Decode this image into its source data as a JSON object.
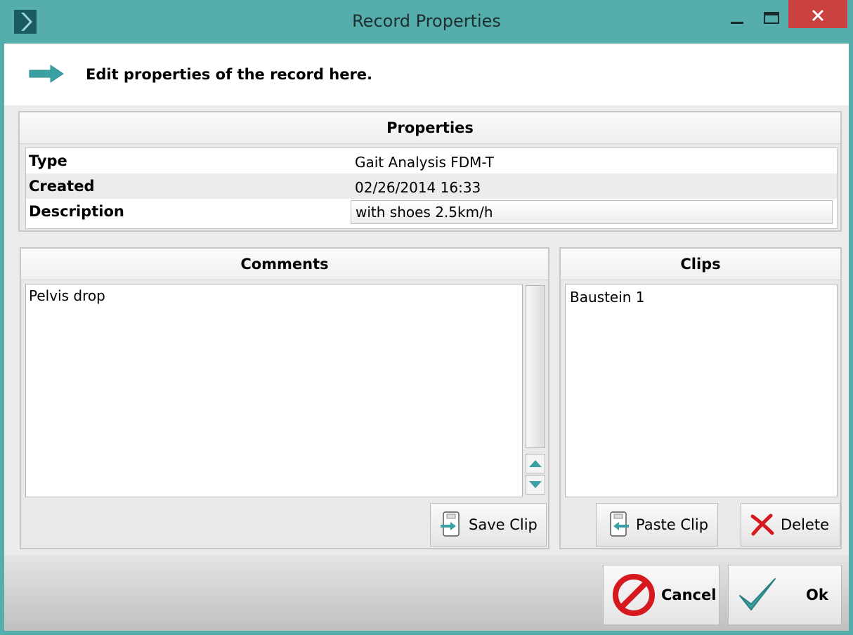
{
  "window": {
    "title": "Record Properties",
    "icons": {
      "app": "app-logo-icon",
      "minimize": "minimize-icon",
      "maximize": "maximize-icon",
      "close": "close-icon"
    }
  },
  "header": {
    "icon": "arrow-right-icon",
    "text": "Edit properties of the record here."
  },
  "properties": {
    "title": "Properties",
    "rows": [
      {
        "label": "Type",
        "value": "Gait Analysis FDM-T"
      },
      {
        "label": "Created",
        "value": "02/26/2014 16:33"
      },
      {
        "label": "Description",
        "value": "with shoes 2.5km/h"
      }
    ]
  },
  "comments": {
    "title": "Comments",
    "text": "Pelvis drop",
    "save_clip_label": "Save Clip"
  },
  "clips": {
    "title": "Clips",
    "items": [
      "Baustein 1"
    ],
    "paste_clip_label": "Paste Clip",
    "delete_label": "Delete"
  },
  "footer": {
    "cancel_label": "Cancel",
    "ok_label": "Ok"
  },
  "colors": {
    "titlebar": "#55aeac",
    "close": "#c9423f",
    "accent_teal": "#3aa0a4",
    "cancel_red": "#d5191f"
  }
}
